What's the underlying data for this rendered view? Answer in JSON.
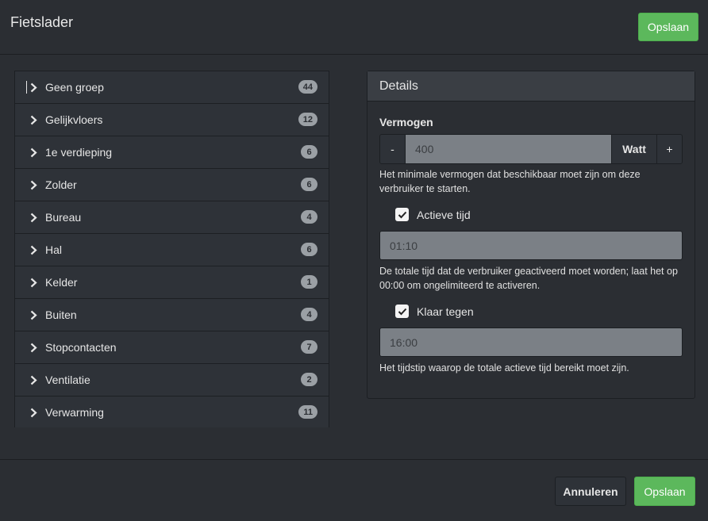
{
  "dialog": {
    "title": "Fietslader",
    "save_top_label": "Opslaan"
  },
  "groups": [
    {
      "label": "Geen groep",
      "count": "44"
    },
    {
      "label": "Gelijkvloers",
      "count": "12"
    },
    {
      "label": "1e verdieping",
      "count": "6"
    },
    {
      "label": "Zolder",
      "count": "6"
    },
    {
      "label": "Bureau",
      "count": "4"
    },
    {
      "label": "Hal",
      "count": "6"
    },
    {
      "label": "Kelder",
      "count": "1"
    },
    {
      "label": "Buiten",
      "count": "4"
    },
    {
      "label": "Stopcontacten",
      "count": "7"
    },
    {
      "label": "Ventilatie",
      "count": "2"
    },
    {
      "label": "Verwarming",
      "count": "11"
    }
  ],
  "details": {
    "title": "Details",
    "power_label": "Vermogen",
    "power_minus": "-",
    "power_value": "400",
    "power_unit": "Watt",
    "power_plus": "+",
    "power_help": "Het minimale vermogen dat beschikbaar moet zijn om deze verbruiker te starten.",
    "active_time_label": "Actieve tijd",
    "active_time_value": "01:10",
    "active_time_help": "De totale tijd dat de verbruiker geactiveerd moet worden; laat het op 00:00 om ongelimiteerd te activeren.",
    "ready_by_label": "Klaar tegen",
    "ready_by_value": "16:00",
    "ready_by_help": "Het tijdstip waarop de totale actieve tijd bereikt moet zijn."
  },
  "footer": {
    "cancel_label": "Annuleren",
    "save_label": "Opslaan"
  },
  "colors": {
    "background": "#2b2e33",
    "accent_green": "#5cb85c",
    "input_fill": "#7b8086",
    "badge": "#9ba0a5"
  },
  "icons": {
    "chevron": "chevron-right-icon",
    "checkbox": "checkmark-icon",
    "scroll_up": "arrow-up-icon",
    "scroll_down": "arrow-down-icon"
  }
}
